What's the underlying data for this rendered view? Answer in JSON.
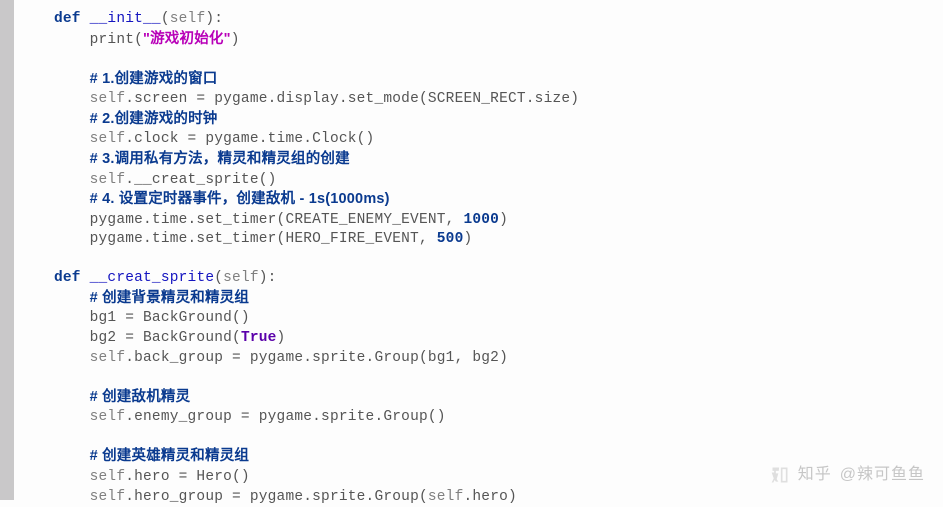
{
  "code": {
    "l1_def": "def",
    "l1_fn": "__init__",
    "l1_open": "(",
    "l1_self": "self",
    "l1_close": "):",
    "l2_indent": "    ",
    "l2_print": "print",
    "l2_open": "(",
    "l2_str": "\"游戏初始化\"",
    "l2_close": ")",
    "l4_cmt": "# 1.创建游戏的窗口",
    "l5": "self.screen = pygame.display.set_mode(SCREEN_RECT.size)",
    "l5_self": "self",
    "l5_rest": ".screen = pygame.display.set_mode(SCREEN_RECT.size)",
    "l6_cmt": "# 2.创建游戏的时钟",
    "l7_self": "self",
    "l7_rest": ".clock = pygame.time.Clock()",
    "l8_cmt": "# 3.调用私有方法，精灵和精灵组的创建",
    "l9_self": "self",
    "l9_rest": ".__creat_sprite()",
    "l10_cmt": "# 4. 设置定时器事件，创建敌机 - 1s(1000ms)",
    "l11": "pygame.time.set_timer(CREATE_ENEMY_EVENT, ",
    "l11_num": "1000",
    "l11_end": ")",
    "l12": "pygame.time.set_timer(HERO_FIRE_EVENT, ",
    "l12_num": "500",
    "l12_end": ")",
    "l14_def": "def",
    "l14_fn": "__creat_sprite",
    "l14_open": "(",
    "l14_self": "self",
    "l14_close": "):",
    "l15_cmt": "# 创建背景精灵和精灵组",
    "l16": "bg1 = BackGround()",
    "l17a": "bg2 = BackGround(",
    "l17_true": "True",
    "l17b": ")",
    "l18_self": "self",
    "l18_rest": ".back_group = pygame.sprite.Group(bg1, bg2)",
    "l20_cmt": "# 创建敌机精灵",
    "l21_self": "self",
    "l21_rest": ".enemy_group = pygame.sprite.Group()",
    "l23_cmt": "# 创建英雄精灵和精灵组",
    "l24_self": "self",
    "l24_rest": ".hero = Hero()",
    "l25_self": "self",
    "l25_mid": ".hero_group = pygame.sprite.Group(",
    "l25_self2": "self",
    "l25_end": ".hero)"
  },
  "watermark": {
    "brand": "知乎",
    "handle": "@辣可鱼鱼"
  }
}
